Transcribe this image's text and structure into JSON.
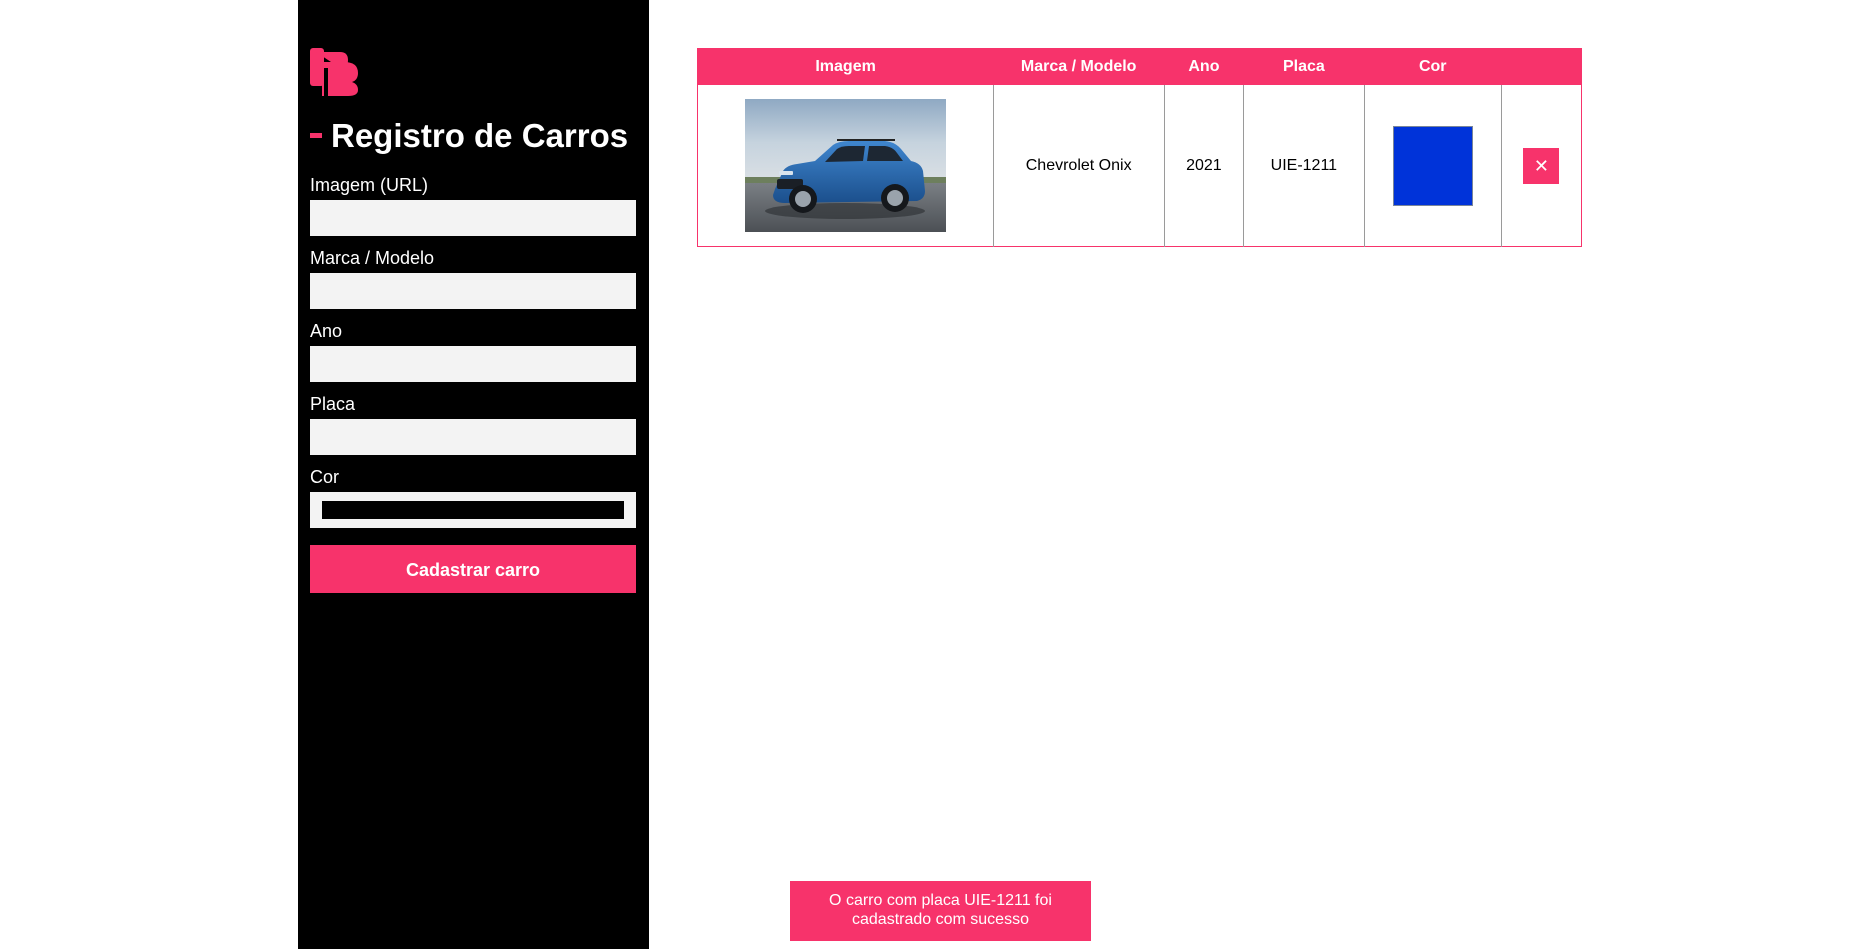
{
  "sidebar": {
    "logo": "logo-icon",
    "title": "Registro de Carros",
    "fields": [
      {
        "label": "Imagem (URL)",
        "value": ""
      },
      {
        "label": "Marca / Modelo",
        "value": ""
      },
      {
        "label": "Ano",
        "value": ""
      },
      {
        "label": "Placa",
        "value": ""
      }
    ],
    "color_field": {
      "label": "Cor",
      "value": "#000000"
    },
    "submit_label": "Cadastrar carro"
  },
  "table": {
    "headers": [
      "Imagem",
      "Marca / Modelo",
      "Ano",
      "Placa",
      "Cor",
      ""
    ],
    "rows": [
      {
        "model": "Chevrolet Onix",
        "year": "2021",
        "plate": "UIE-1211",
        "color": "#0033d9",
        "remove_icon": "✕"
      }
    ]
  },
  "toast": {
    "message": "O carro com placa UIE-1211 foi cadastrado com sucesso"
  },
  "colors": {
    "accent": "#f7336b",
    "sidebar_bg": "#000000",
    "input_bg": "#f3f3f3"
  }
}
